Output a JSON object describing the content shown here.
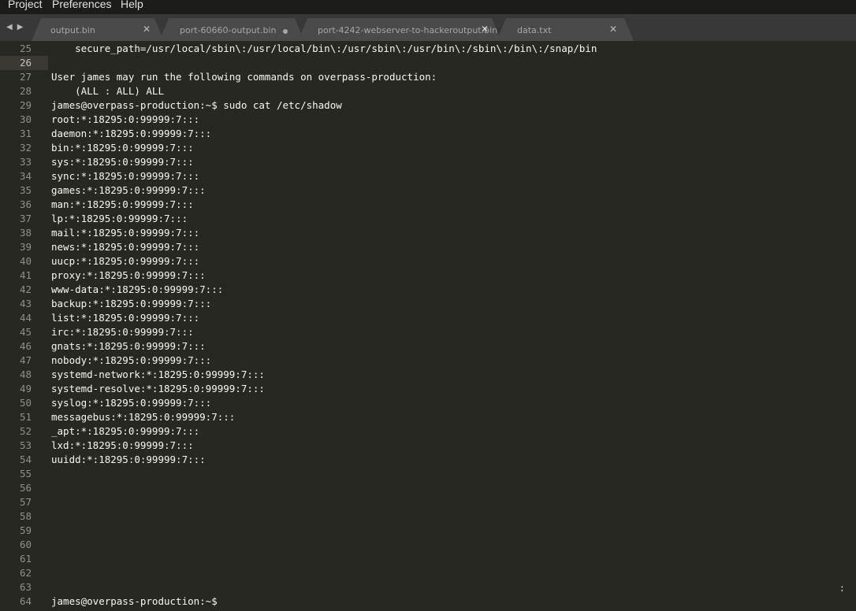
{
  "menu": {
    "items": [
      "Project",
      "Preferences",
      "Help"
    ]
  },
  "tabs": [
    {
      "label": "output.bin",
      "state": "close",
      "active": false
    },
    {
      "label": "port-60660-output.bin",
      "state": "modified",
      "active": false
    },
    {
      "label": "port-4242-webserver-to-hackeroutput.bin",
      "state": "close",
      "active": true
    },
    {
      "label": "data.txt",
      "state": "close",
      "active": false
    }
  ],
  "editor": {
    "current_line": 26,
    "lines": [
      {
        "n": "25",
        "text": "    secure_path=/usr/local/sbin\\:/usr/local/bin\\:/usr/sbin\\:/usr/bin\\:/sbin\\:/bin\\:/snap/bin"
      },
      {
        "n": "26",
        "text": ""
      },
      {
        "n": "27",
        "text": "User james may run the following commands on overpass-production:"
      },
      {
        "n": "28",
        "text": "    (ALL : ALL) ALL"
      },
      {
        "n": "29",
        "text": "james@overpass-production:~$ sudo cat /etc/shadow"
      },
      {
        "n": "30",
        "text": "root:*:18295:0:99999:7:::"
      },
      {
        "n": "31",
        "text": "daemon:*:18295:0:99999:7:::"
      },
      {
        "n": "32",
        "text": "bin:*:18295:0:99999:7:::"
      },
      {
        "n": "33",
        "text": "sys:*:18295:0:99999:7:::"
      },
      {
        "n": "34",
        "text": "sync:*:18295:0:99999:7:::"
      },
      {
        "n": "35",
        "text": "games:*:18295:0:99999:7:::"
      },
      {
        "n": "36",
        "text": "man:*:18295:0:99999:7:::"
      },
      {
        "n": "37",
        "text": "lp:*:18295:0:99999:7:::"
      },
      {
        "n": "38",
        "text": "mail:*:18295:0:99999:7:::"
      },
      {
        "n": "39",
        "text": "news:*:18295:0:99999:7:::"
      },
      {
        "n": "40",
        "text": "uucp:*:18295:0:99999:7:::"
      },
      {
        "n": "41",
        "text": "proxy:*:18295:0:99999:7:::"
      },
      {
        "n": "42",
        "text": "www-data:*:18295:0:99999:7:::"
      },
      {
        "n": "43",
        "text": "backup:*:18295:0:99999:7:::"
      },
      {
        "n": "44",
        "text": "list:*:18295:0:99999:7:::"
      },
      {
        "n": "45",
        "text": "irc:*:18295:0:99999:7:::"
      },
      {
        "n": "46",
        "text": "gnats:*:18295:0:99999:7:::"
      },
      {
        "n": "47",
        "text": "nobody:*:18295:0:99999:7:::"
      },
      {
        "n": "48",
        "text": "systemd-network:*:18295:0:99999:7:::"
      },
      {
        "n": "49",
        "text": "systemd-resolve:*:18295:0:99999:7:::"
      },
      {
        "n": "50",
        "text": "syslog:*:18295:0:99999:7:::"
      },
      {
        "n": "51",
        "text": "messagebus:*:18295:0:99999:7:::"
      },
      {
        "n": "52",
        "text": "_apt:*:18295:0:99999:7:::"
      },
      {
        "n": "53",
        "text": "lxd:*:18295:0:99999:7:::"
      },
      {
        "n": "54",
        "text": "uuidd:*:18295:0:99999:7:::"
      },
      {
        "n": "55",
        "text": ""
      },
      {
        "n": "56",
        "text": ""
      },
      {
        "n": "57",
        "text": ""
      },
      {
        "n": "58",
        "text": ""
      },
      {
        "n": "59",
        "text": ""
      },
      {
        "n": "60",
        "text": ""
      },
      {
        "n": "61",
        "text": ""
      },
      {
        "n": "62",
        "text": ""
      },
      {
        "n": "63",
        "text": ""
      },
      {
        "n": "64",
        "text": "james@overpass-production:~$"
      }
    ],
    "right_marker": ":"
  },
  "colors": {
    "background": "#272822",
    "text": "#f8f8f2",
    "gutter_text": "#90908a",
    "tabbar": "#383838"
  }
}
